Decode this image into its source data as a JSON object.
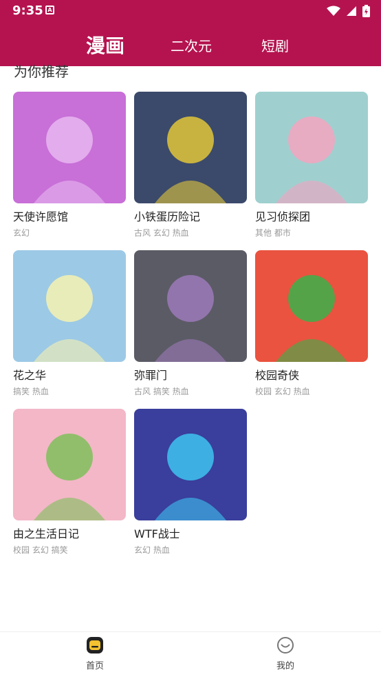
{
  "status_bar": {
    "time": "9:35",
    "notification_glyph": "A"
  },
  "tabs": [
    {
      "label": "漫画",
      "active": true
    },
    {
      "label": "二次元",
      "active": false
    },
    {
      "label": "短剧",
      "active": false
    }
  ],
  "section_title": "为你推荐",
  "comics": [
    {
      "title": "天使许愿馆",
      "tags": "玄幻",
      "cover_color": "#c86fd8",
      "cover_accent": "#e8b7f0"
    },
    {
      "title": "小铁蛋历险记",
      "tags": "古风 玄幻 热血",
      "cover_color": "#3b4a6b",
      "cover_accent": "#e2c63a"
    },
    {
      "title": "见习侦探团",
      "tags": "其他 都市",
      "cover_color": "#9fd0cf",
      "cover_accent": "#f3a4c0"
    },
    {
      "title": "花之华",
      "tags": "搞笑 热血",
      "cover_color": "#9cc9e6",
      "cover_accent": "#f6f2b0"
    },
    {
      "title": "弥罪门",
      "tags": "古风 搞笑 热血",
      "cover_color": "#5b5b66",
      "cover_accent": "#9c7ab8"
    },
    {
      "title": "校园奇侠",
      "tags": "校园 玄幻 热血",
      "cover_color": "#e9533f",
      "cover_accent": "#3bb24a"
    },
    {
      "title": "由之生活日记",
      "tags": "校园 玄幻 搞笑",
      "cover_color": "#f3b7c7",
      "cover_accent": "#7fbf5a"
    },
    {
      "title": "WTF战士",
      "tags": "玄幻 热血",
      "cover_color": "#3a3e9c",
      "cover_accent": "#3ec3f0"
    }
  ],
  "bottom_nav": [
    {
      "label": "首页",
      "icon": "home-icon",
      "active": true
    },
    {
      "label": "我的",
      "icon": "profile-icon",
      "active": false
    }
  ],
  "colors": {
    "brand": "#b5134f",
    "nav_icon_active": "#f2c230"
  }
}
